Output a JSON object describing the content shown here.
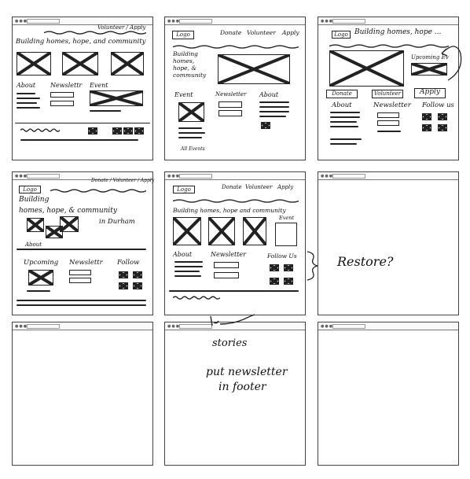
{
  "sketches": {
    "s1": {
      "nav_cta": "Volunteer / Apply",
      "tagline": "Building homes, hope, and community",
      "about": "About",
      "newsletter": "Newslettr",
      "event": "Event"
    },
    "s2": {
      "logo": "Logo",
      "donate": "Donate",
      "volunteer": "Volunteer",
      "apply": "Apply",
      "hero_text": "Building homes, hope, & community",
      "event": "Event",
      "newsletter": "Newsletter",
      "about": "About",
      "all_events": "All Events"
    },
    "s3": {
      "logo": "Logo",
      "tagline": "Building homes, hope ...",
      "upcoming": "Upcoming Ev",
      "donate": "Donate",
      "volunteer": "Volunteer",
      "apply": "Apply",
      "about": "About",
      "newsletter": "Newsletter",
      "follow": "Follow us"
    },
    "s4": {
      "logo": "Logo",
      "nav_cta": "Donate / Volunteer / Apply",
      "tagline_1": "Building",
      "tagline_2": "homes, hope, & community",
      "tagline_3": "in Durham",
      "about": "About",
      "upcoming": "Upcoming",
      "newsletter": "Newslettr",
      "follow": "Follow"
    },
    "s5": {
      "logo": "Logo",
      "donate": "Donate",
      "volunteer": "Volunteer",
      "apply": "Apply",
      "tagline": "Building homes, hope and community",
      "event": "Event",
      "about": "About",
      "newsletter": "Newsletter",
      "follow": "Follow Us"
    },
    "s6": {
      "note": "Restore?"
    },
    "s8": {
      "stories": "stories",
      "note_1": "put newsletter",
      "note_2": "in footer"
    }
  },
  "icons": {
    "placeholder": "image-placeholder-icon",
    "social": "social-icon",
    "scribble": "scribble-text"
  }
}
